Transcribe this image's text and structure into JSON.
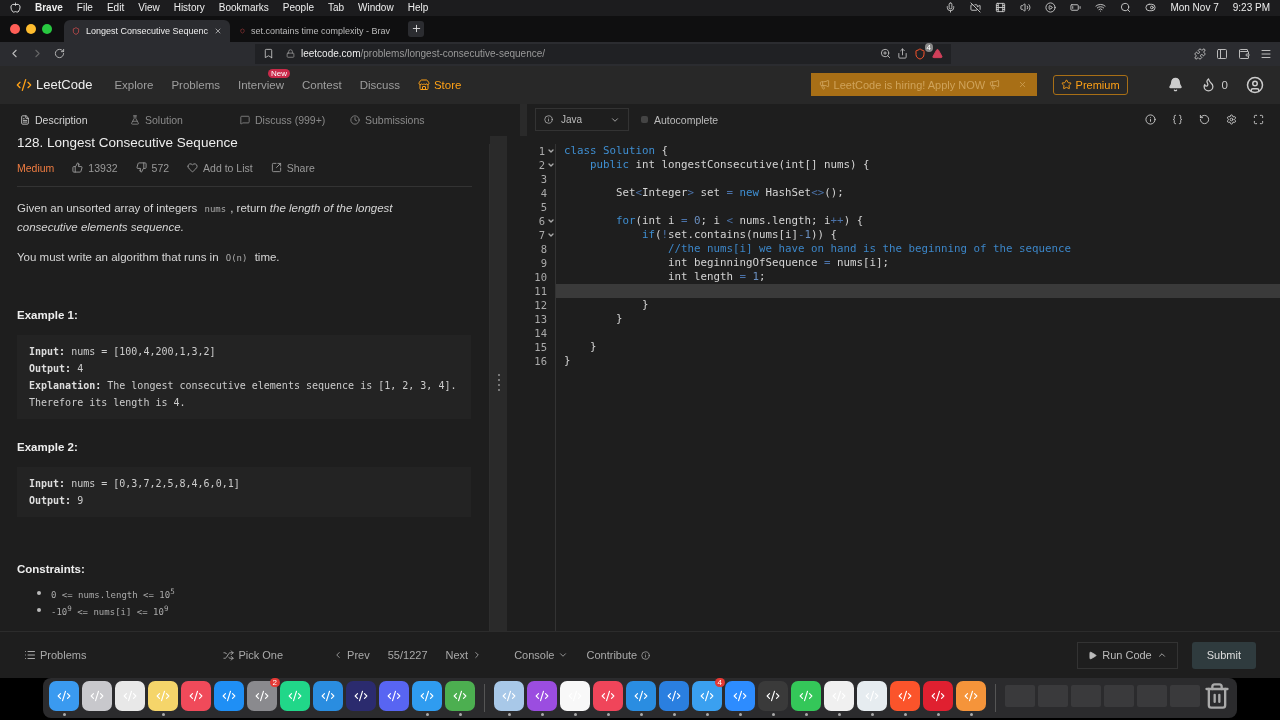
{
  "menu_bar": {
    "app": "Brave",
    "items": [
      "File",
      "Edit",
      "View",
      "History",
      "Bookmarks",
      "People",
      "Tab",
      "Window",
      "Help"
    ],
    "date": "Mon Nov 7",
    "time": "9:23 PM"
  },
  "browser": {
    "tabs": [
      {
        "title": "Longest Consecutive Sequenc",
        "selected": true
      },
      {
        "title": "set.contains time complexity - Brav",
        "selected": false
      }
    ],
    "host": "leetcode.com",
    "path": "/problems/longest-consecutive-sequence/",
    "shield_badge": "4"
  },
  "nav": {
    "brand": "LeetCode",
    "items": [
      {
        "label": "Explore",
        "kind": "link"
      },
      {
        "label": "Problems",
        "kind": "link"
      },
      {
        "label": "Interview",
        "kind": "link",
        "badge": "New"
      },
      {
        "label": "Contest",
        "kind": "link"
      },
      {
        "label": "Discuss",
        "kind": "link"
      },
      {
        "label": "Store",
        "kind": "store"
      }
    ],
    "banner": "LeetCode is hiring! Apply NOW",
    "premium": "Premium",
    "streak": "0"
  },
  "left_tabs": [
    {
      "label": "Description",
      "selected": true
    },
    {
      "label": "Solution",
      "selected": false
    },
    {
      "label": "Discuss (999+)",
      "selected": false
    },
    {
      "label": "Submissions",
      "selected": false
    }
  ],
  "problem": {
    "title": "128. Longest Consecutive Sequence",
    "difficulty": "Medium",
    "likes": "13932",
    "dislikes": "572",
    "add": "Add to List",
    "share": "Share",
    "paragraphs": [
      [
        {
          "kind": "plain",
          "text": "Given an unsorted array of integers "
        },
        {
          "kind": "code",
          "text": "nums"
        },
        {
          "kind": "plain",
          "text": ", return "
        },
        {
          "kind": "italic",
          "text": "the length of the longest consecutive elements sequence."
        }
      ],
      [
        {
          "kind": "plain",
          "text": "You must write an algorithm that runs in "
        },
        {
          "kind": "code",
          "text": "O(n)"
        },
        {
          "kind": "plain",
          "text": " time."
        }
      ]
    ],
    "examples": [
      {
        "heading": "Example 1:",
        "lines": [
          "**Input:** nums = [100,4,200,1,3,2]",
          "**Output:** 4",
          "**Explanation:** The longest consecutive elements sequence is [1, 2, 3, 4]. Therefore its length is 4."
        ]
      },
      {
        "heading": "Example 2:",
        "lines": [
          "**Input:** nums = [0,3,7,2,5,8,4,6,0,1]",
          "**Output:** 9"
        ]
      }
    ],
    "constraints_heading": "Constraints:",
    "constraints": [
      "0 <= nums.length <= 10$^{5}$",
      "-10$^{9}$ <= nums[i] <= 10$^{9}$"
    ]
  },
  "editor": {
    "language": "Java",
    "autocomplete": {
      "label": "Autocomplete",
      "checked": false
    },
    "lines": [
      {
        "number": "1",
        "foldable": true,
        "active": false,
        "tokens": [
          {
            "kind": "keyword",
            "text": "class Solution"
          },
          {
            "kind": "plain",
            "text": " {"
          }
        ]
      },
      {
        "number": "2",
        "foldable": true,
        "active": false,
        "tokens": [
          {
            "kind": "keyword",
            "text": "    public"
          },
          {
            "kind": "plain",
            "text": " int longestConsecutive(int[] nums) {"
          }
        ]
      },
      {
        "number": "3",
        "foldable": false,
        "active": false
      },
      {
        "number": "4",
        "foldable": false,
        "active": false,
        "tokens": [
          {
            "kind": "plain",
            "text": "        Set"
          },
          {
            "kind": "operator",
            "text": "<"
          },
          {
            "kind": "plain",
            "text": "Integer"
          },
          {
            "kind": "operator",
            "text": ">"
          },
          {
            "kind": "plain",
            "text": " set "
          },
          {
            "kind": "operator",
            "text": "="
          },
          {
            "kind": "keyword",
            "text": " new"
          },
          {
            "kind": "plain",
            "text": " HashSet"
          },
          {
            "kind": "operator",
            "text": "<>"
          },
          {
            "kind": "plain",
            "text": "();"
          }
        ]
      },
      {
        "number": "5",
        "foldable": false,
        "active": false
      },
      {
        "number": "6",
        "foldable": true,
        "active": false,
        "tokens": [
          {
            "kind": "keyword",
            "text": "        for"
          },
          {
            "kind": "plain",
            "text": "(int i "
          },
          {
            "kind": "operator",
            "text": "="
          },
          {
            "kind": "number",
            "text": " 0"
          },
          {
            "kind": "plain",
            "text": "; i "
          },
          {
            "kind": "operator",
            "text": "<"
          },
          {
            "kind": "plain",
            "text": " nums.length; i"
          },
          {
            "kind": "operator",
            "text": "++"
          },
          {
            "kind": "plain",
            "text": ") {"
          }
        ]
      },
      {
        "number": "7",
        "foldable": true,
        "active": false,
        "tokens": [
          {
            "kind": "keyword",
            "text": "            if"
          },
          {
            "kind": "plain",
            "text": "("
          },
          {
            "kind": "operator",
            "text": "!"
          },
          {
            "kind": "plain",
            "text": "set.contains(nums[i]"
          },
          {
            "kind": "operator",
            "text": "-"
          },
          {
            "kind": "number",
            "text": "1"
          },
          {
            "kind": "plain",
            "text": ")) {"
          }
        ]
      },
      {
        "number": "8",
        "foldable": false,
        "active": false,
        "tokens": [
          {
            "kind": "comment",
            "text": "                //the nums[i] we have on hand is the beginning of the sequence"
          }
        ]
      },
      {
        "number": "9",
        "foldable": false,
        "active": false,
        "tokens": [
          {
            "kind": "plain",
            "text": "                int beginningOfSequence "
          },
          {
            "kind": "operator",
            "text": "="
          },
          {
            "kind": "plain",
            "text": " nums[i];"
          }
        ]
      },
      {
        "number": "10",
        "foldable": false,
        "active": false,
        "tokens": [
          {
            "kind": "plain",
            "text": "                int length "
          },
          {
            "kind": "operator",
            "text": "="
          },
          {
            "kind": "number",
            "text": " 1"
          },
          {
            "kind": "plain",
            "text": ";"
          }
        ]
      },
      {
        "number": "11",
        "foldable": false,
        "active": true
      },
      {
        "number": "12",
        "foldable": false,
        "active": false,
        "tokens": [
          {
            "kind": "plain",
            "text": "            }"
          }
        ]
      },
      {
        "number": "13",
        "foldable": false,
        "active": false,
        "tokens": [
          {
            "kind": "plain",
            "text": "        }"
          }
        ]
      },
      {
        "number": "14",
        "foldable": false,
        "active": false
      },
      {
        "number": "15",
        "foldable": false,
        "active": false,
        "tokens": [
          {
            "kind": "plain",
            "text": "    }"
          }
        ]
      },
      {
        "number": "16",
        "foldable": false,
        "active": false,
        "tokens": [
          {
            "kind": "plain",
            "text": "}"
          }
        ]
      }
    ]
  },
  "bottom_bar": {
    "problems": "Problems",
    "pick": "Pick One",
    "prev": "Prev",
    "counter": "55/1227",
    "next": "Next",
    "console": "Console",
    "contribute": "Contribute",
    "run": "Run Code",
    "submit": "Submit"
  },
  "dock": {
    "sections": [
      [
        {
          "kind": "app",
          "color": "#3a9af0",
          "running": true
        },
        {
          "kind": "app",
          "color": "#c8c8cc",
          "running": false
        },
        {
          "kind": "app",
          "color": "#e8e8e8",
          "running": false
        },
        {
          "kind": "app",
          "color": "#f5d56a",
          "running": true
        },
        {
          "kind": "app",
          "color": "#f04a5a",
          "running": false
        },
        {
          "kind": "app",
          "color": "#1f8ff5",
          "running": false
        },
        {
          "kind": "app",
          "color": "#8a8a8e",
          "running": false,
          "badge": "2"
        },
        {
          "kind": "app",
          "color": "#21d789",
          "running": false
        },
        {
          "kind": "app",
          "color": "#2a8de0",
          "running": false
        },
        {
          "kind": "app",
          "color": "#2b2b6e",
          "running": false
        },
        {
          "kind": "app",
          "color": "#5865f2",
          "running": false
        },
        {
          "kind": "app",
          "color": "#2f9cf0",
          "running": true
        },
        {
          "kind": "app",
          "color": "#4caf50",
          "running": true
        }
      ],
      [
        {
          "kind": "app",
          "color": "#a8c8e8",
          "running": true
        },
        {
          "kind": "app",
          "color": "#9b4de0",
          "running": true
        },
        {
          "kind": "app",
          "color": "#f8f8f8",
          "running": true
        },
        {
          "kind": "app",
          "color": "#f0455a",
          "running": true
        },
        {
          "kind": "app",
          "color": "#2a8de1",
          "running": true
        },
        {
          "kind": "app",
          "color": "#2a7fe0",
          "running": true
        },
        {
          "kind": "app",
          "color": "#3aa0f0",
          "running": true,
          "badge": "4"
        },
        {
          "kind": "app",
          "color": "#2d8cff",
          "running": true
        },
        {
          "kind": "app",
          "color": "#3a3a3a",
          "running": true
        },
        {
          "kind": "app",
          "color": "#34c759",
          "running": true
        },
        {
          "kind": "app",
          "color": "#f0f0f0",
          "running": true
        },
        {
          "kind": "app",
          "color": "#e6ecf0",
          "running": true
        },
        {
          "kind": "app",
          "color": "#fb542b",
          "running": true
        },
        {
          "kind": "app",
          "color": "#e02030",
          "running": true
        },
        {
          "kind": "app",
          "color": "#f5943a",
          "running": true
        }
      ],
      [
        {
          "kind": "window",
          "running": false
        },
        {
          "kind": "window",
          "running": false
        },
        {
          "kind": "window",
          "running": false
        },
        {
          "kind": "window",
          "running": false
        },
        {
          "kind": "window",
          "running": false
        },
        {
          "kind": "window",
          "running": false
        },
        {
          "kind": "trash",
          "running": false
        }
      ]
    ]
  }
}
